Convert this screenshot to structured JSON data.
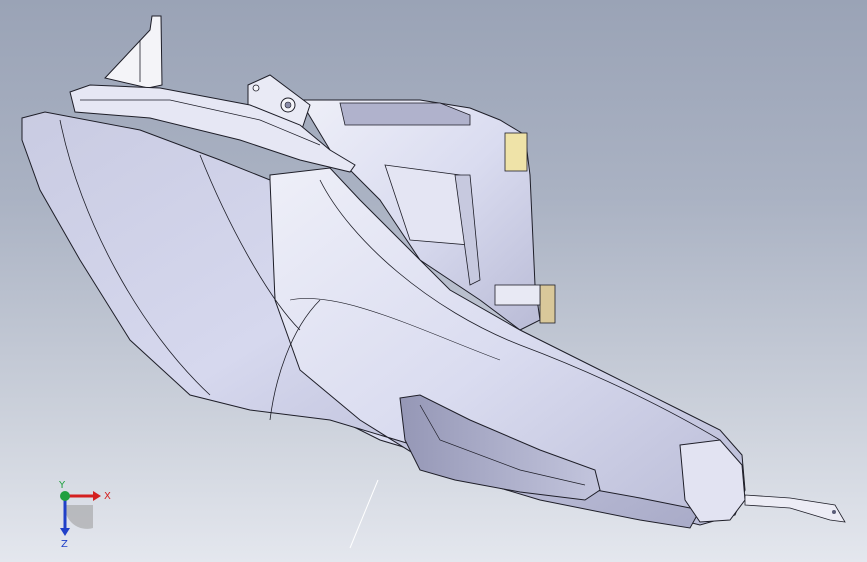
{
  "viewport": {
    "background_top": "#9aa3b6",
    "background_bottom": "#e4e7ee",
    "model_color": "#d8dbf0",
    "edge_color": "#1e1e28"
  },
  "triad": {
    "x_label": "X",
    "y_label": "Y",
    "z_label": "Z",
    "x_color": "#d42020",
    "y_color": "#20a040",
    "z_color": "#2040c8"
  }
}
